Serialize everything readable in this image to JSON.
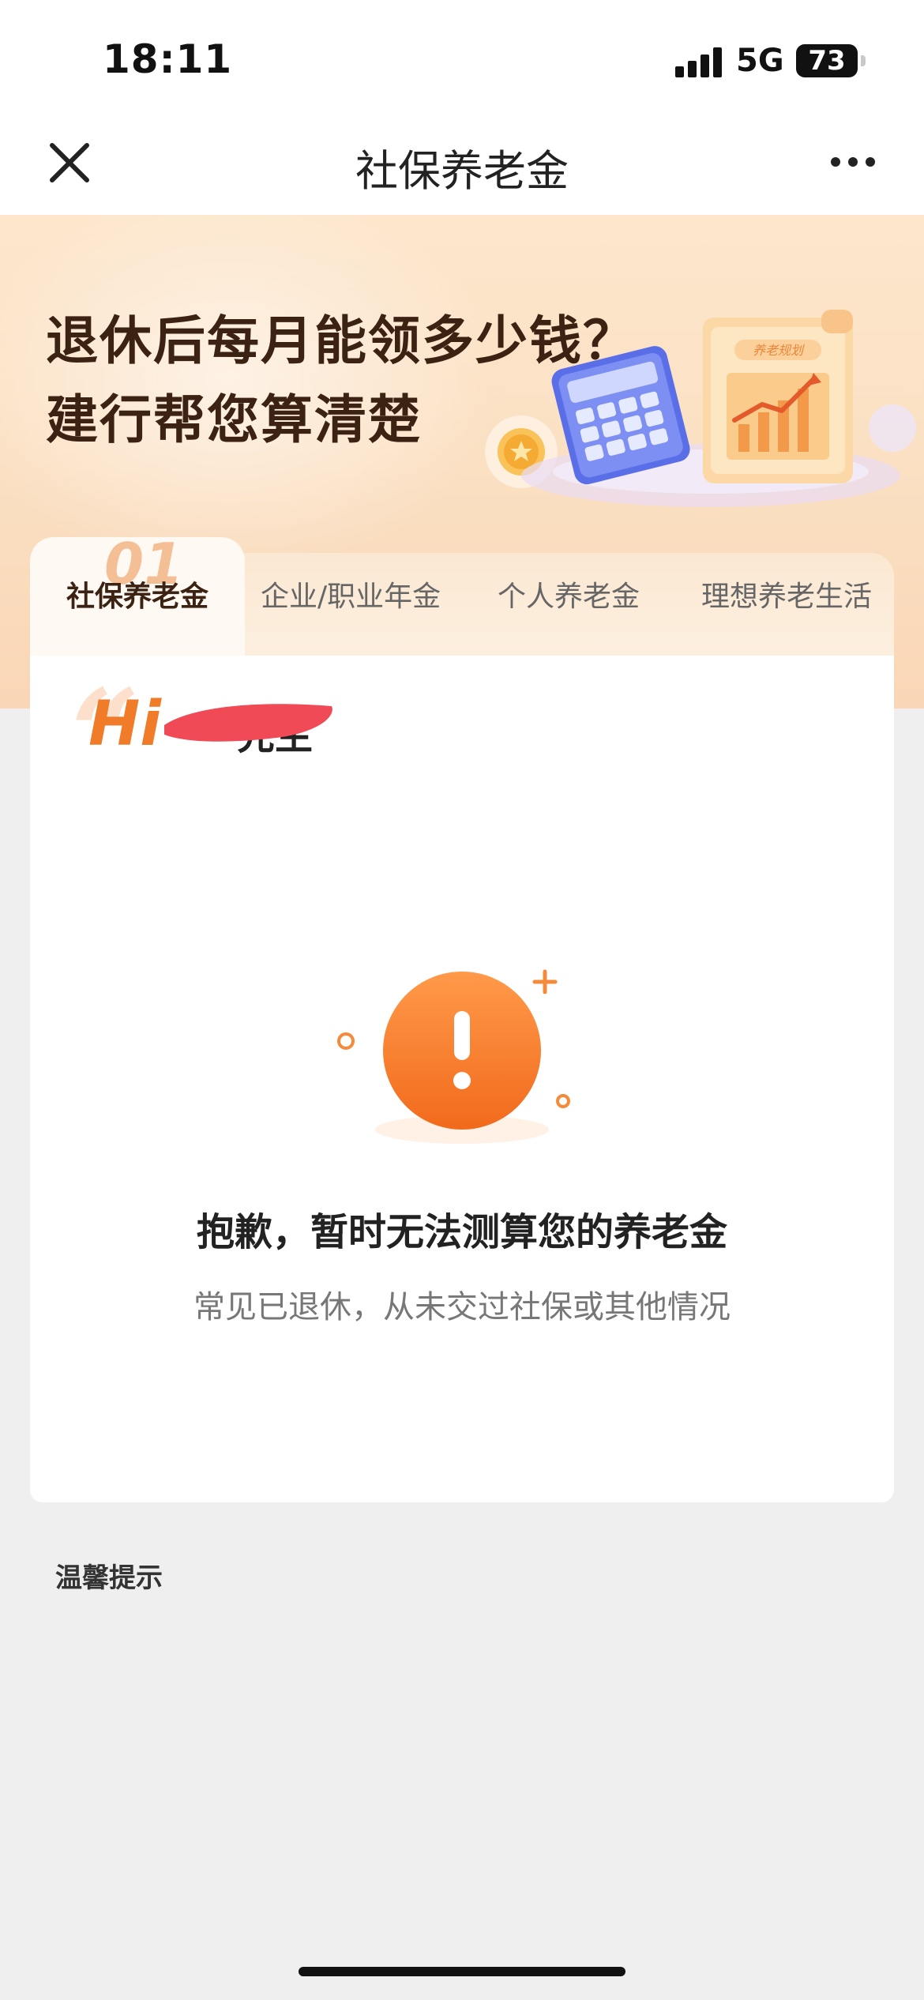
{
  "status_bar": {
    "time": "18:11",
    "network": "5G",
    "battery": "73"
  },
  "nav": {
    "title": "社保养老金",
    "close_icon": "close-icon",
    "more_icon": "more-icon"
  },
  "banner": {
    "headline_line1": "退休后每月能领多少钱？",
    "headline_line2": "建行帮您算清楚",
    "illustration_label": "养老规划"
  },
  "tabs": [
    {
      "label": "社保养老金",
      "number": "01",
      "active": true
    },
    {
      "label": "企业/职业年金",
      "active": false
    },
    {
      "label": "个人养老金",
      "active": false
    },
    {
      "label": "理想养老生活",
      "active": false
    }
  ],
  "card": {
    "greeting": "Hi",
    "greeting_suffix": "先生",
    "error_title": "抱歉，暂时无法测算您的养老金",
    "error_description": "常见已退休，从未交过社保或其他情况"
  },
  "tips": {
    "title": "温馨提示"
  },
  "colors": {
    "accent": "#f07b28",
    "redaction": "#f04a57",
    "banner_bg": "#fde6cc"
  }
}
